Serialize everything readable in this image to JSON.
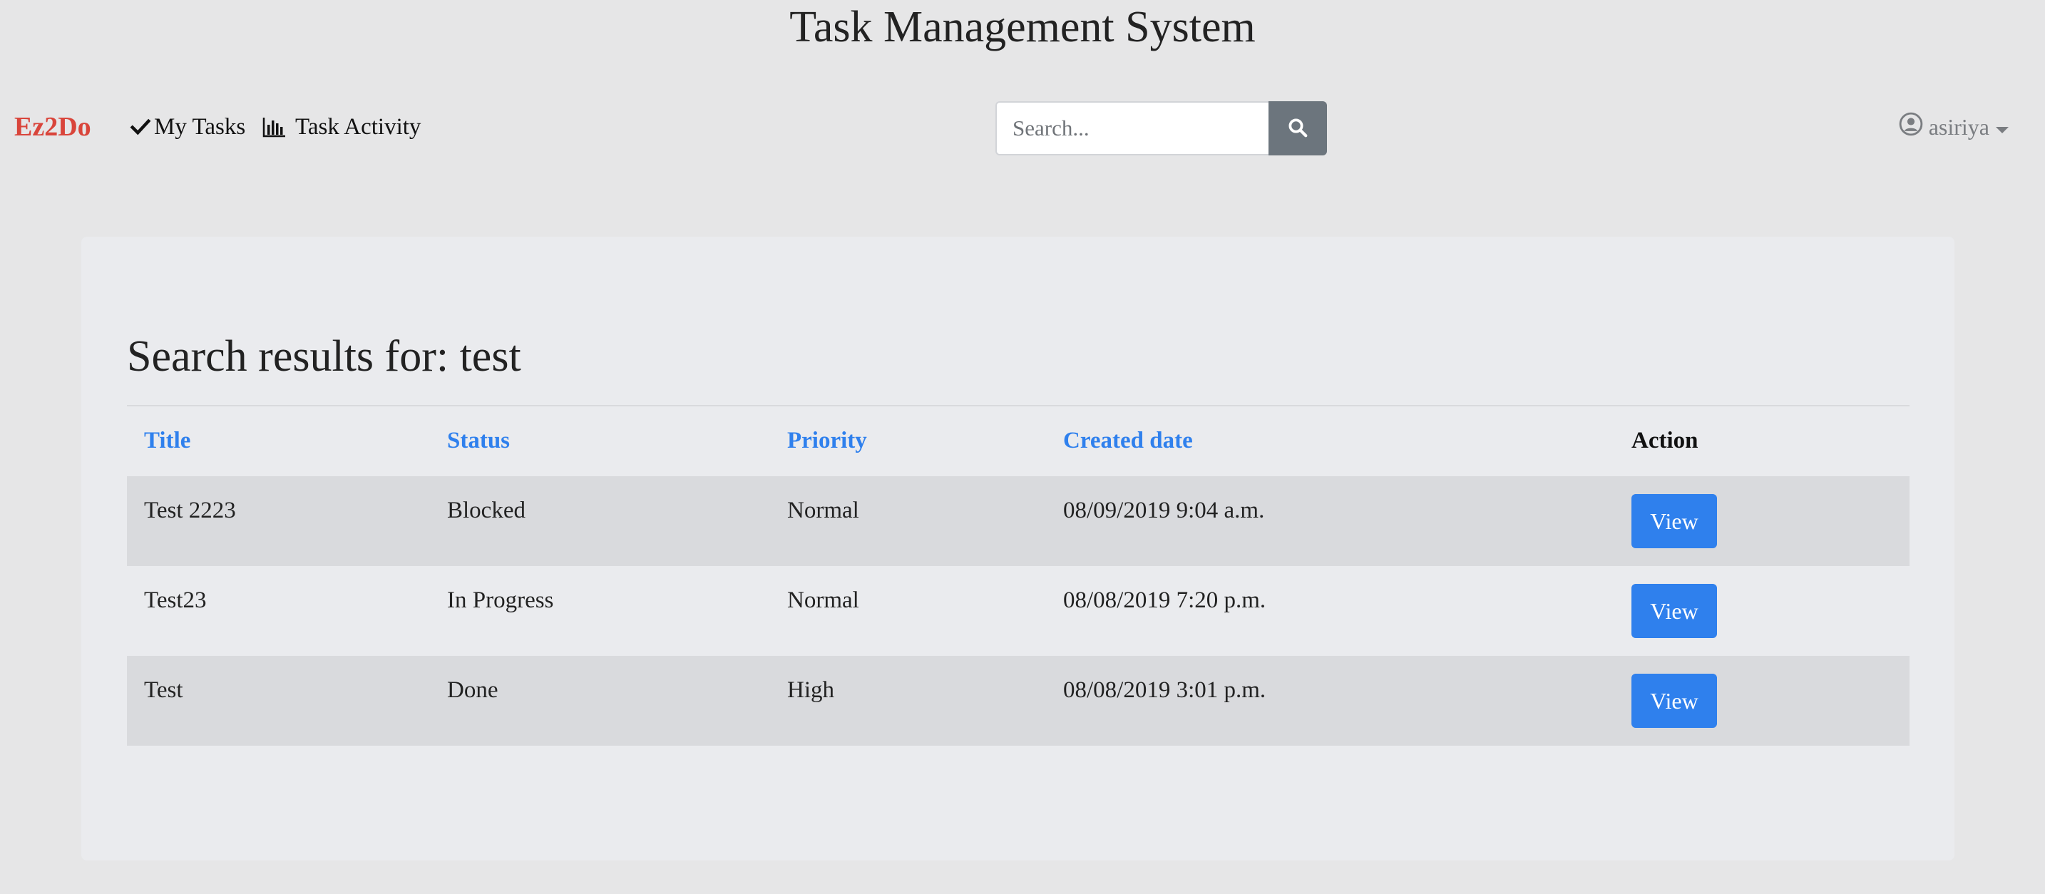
{
  "header": {
    "app_title": "Task Management System"
  },
  "navbar": {
    "brand": "Ez2Do",
    "brand_color": "#d9453b",
    "links": [
      {
        "label": "My Tasks",
        "icon": "check-icon"
      },
      {
        "label": "Task Activity",
        "icon": "bar-chart-icon"
      }
    ],
    "search": {
      "placeholder": "Search...",
      "value": "",
      "button_icon": "search-icon"
    },
    "user": {
      "name": "asiriya",
      "icon": "user-circle-icon"
    }
  },
  "results": {
    "heading": "Search results for: test",
    "columns": [
      "Title",
      "Status",
      "Priority",
      "Created date",
      "Action"
    ],
    "rows": [
      {
        "title": "Test 2223",
        "status": "Blocked",
        "priority": "Normal",
        "created": "08/09/2019 9:04 a.m.",
        "action": "View"
      },
      {
        "title": "Test23",
        "status": "In Progress",
        "priority": "Normal",
        "created": "08/08/2019 7:20 p.m.",
        "action": "View"
      },
      {
        "title": "Test",
        "status": "Done",
        "priority": "High",
        "created": "08/08/2019 3:01 p.m.",
        "action": "View"
      }
    ]
  },
  "colors": {
    "accent": "#2f80ed",
    "search_button": "#6c757d",
    "background": "#e6e6e7"
  }
}
